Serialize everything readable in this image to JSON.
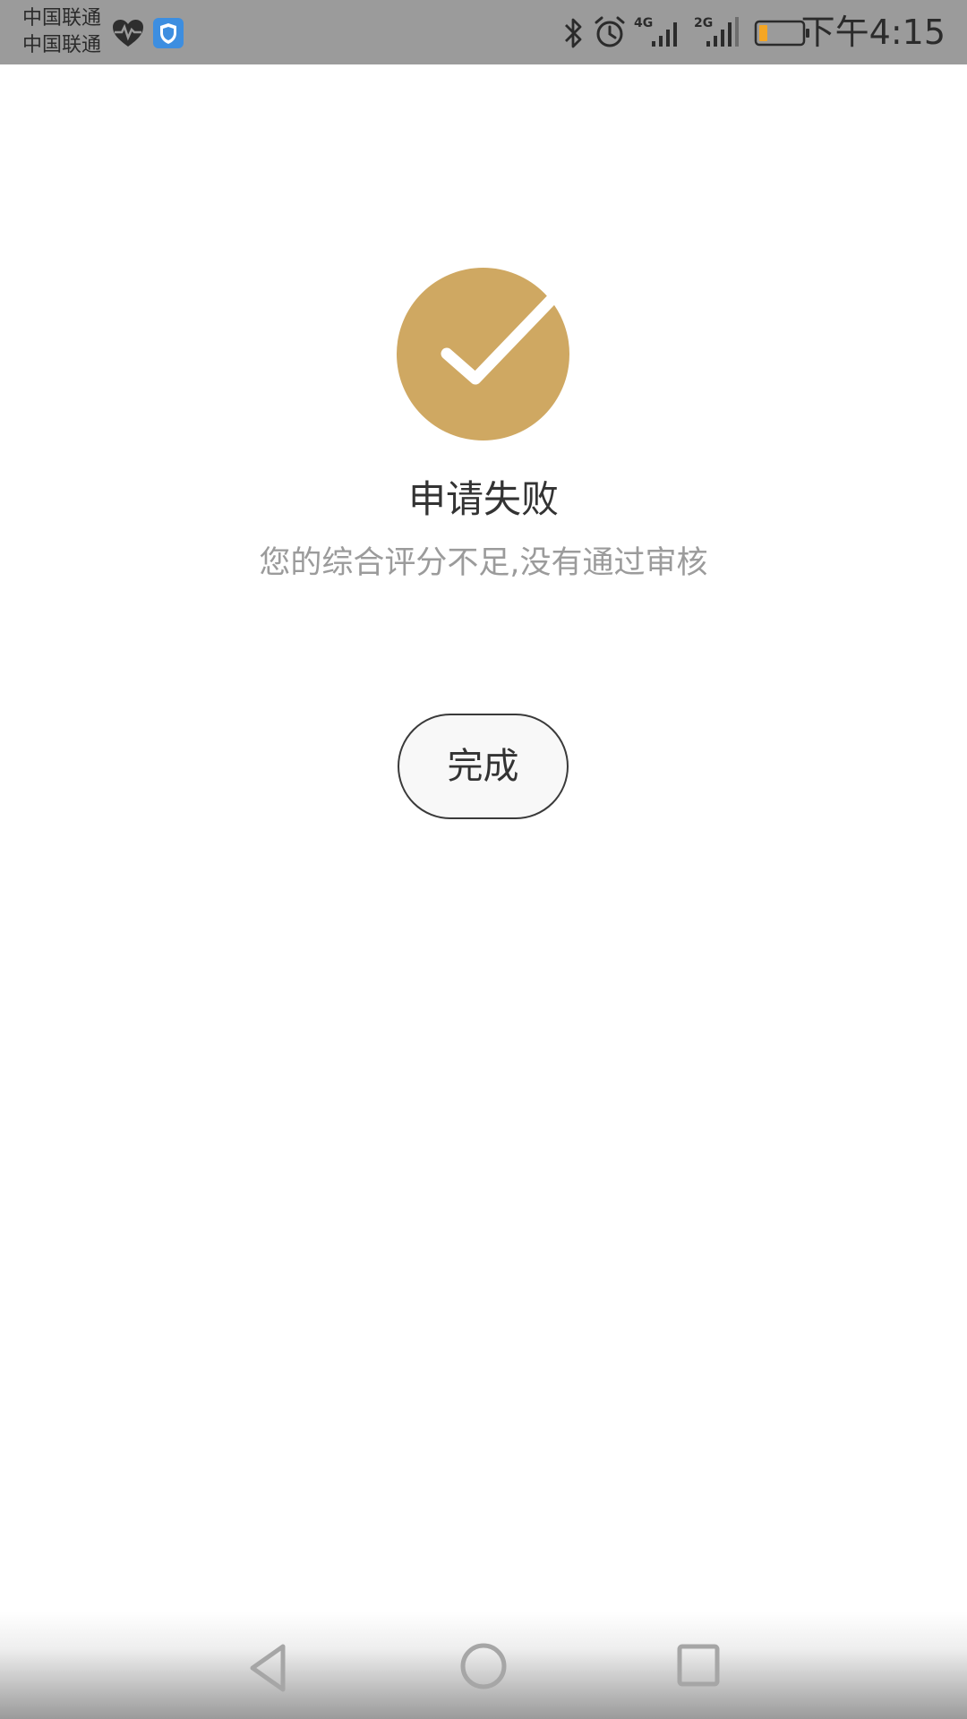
{
  "status_bar": {
    "carriers": [
      "中国联通",
      "中国联通"
    ],
    "time": "下午4:15",
    "icons": [
      "health-icon",
      "shield-icon",
      "bluetooth-icon",
      "alarm-icon",
      "signal-4g-icon",
      "signal-2g-icon",
      "battery-icon"
    ],
    "network_labels": {
      "sim1": "4G",
      "sim2": "2G"
    },
    "battery_color": "#f5a623"
  },
  "result": {
    "icon": "checkmark-circle-icon",
    "icon_color": "#cfa862",
    "title": "申请失败",
    "message": "您的综合评分不足,没有通过审核"
  },
  "actions": {
    "done_label": "完成"
  },
  "nav_bar": {
    "icons": [
      "back-icon",
      "home-icon",
      "recents-icon"
    ]
  }
}
